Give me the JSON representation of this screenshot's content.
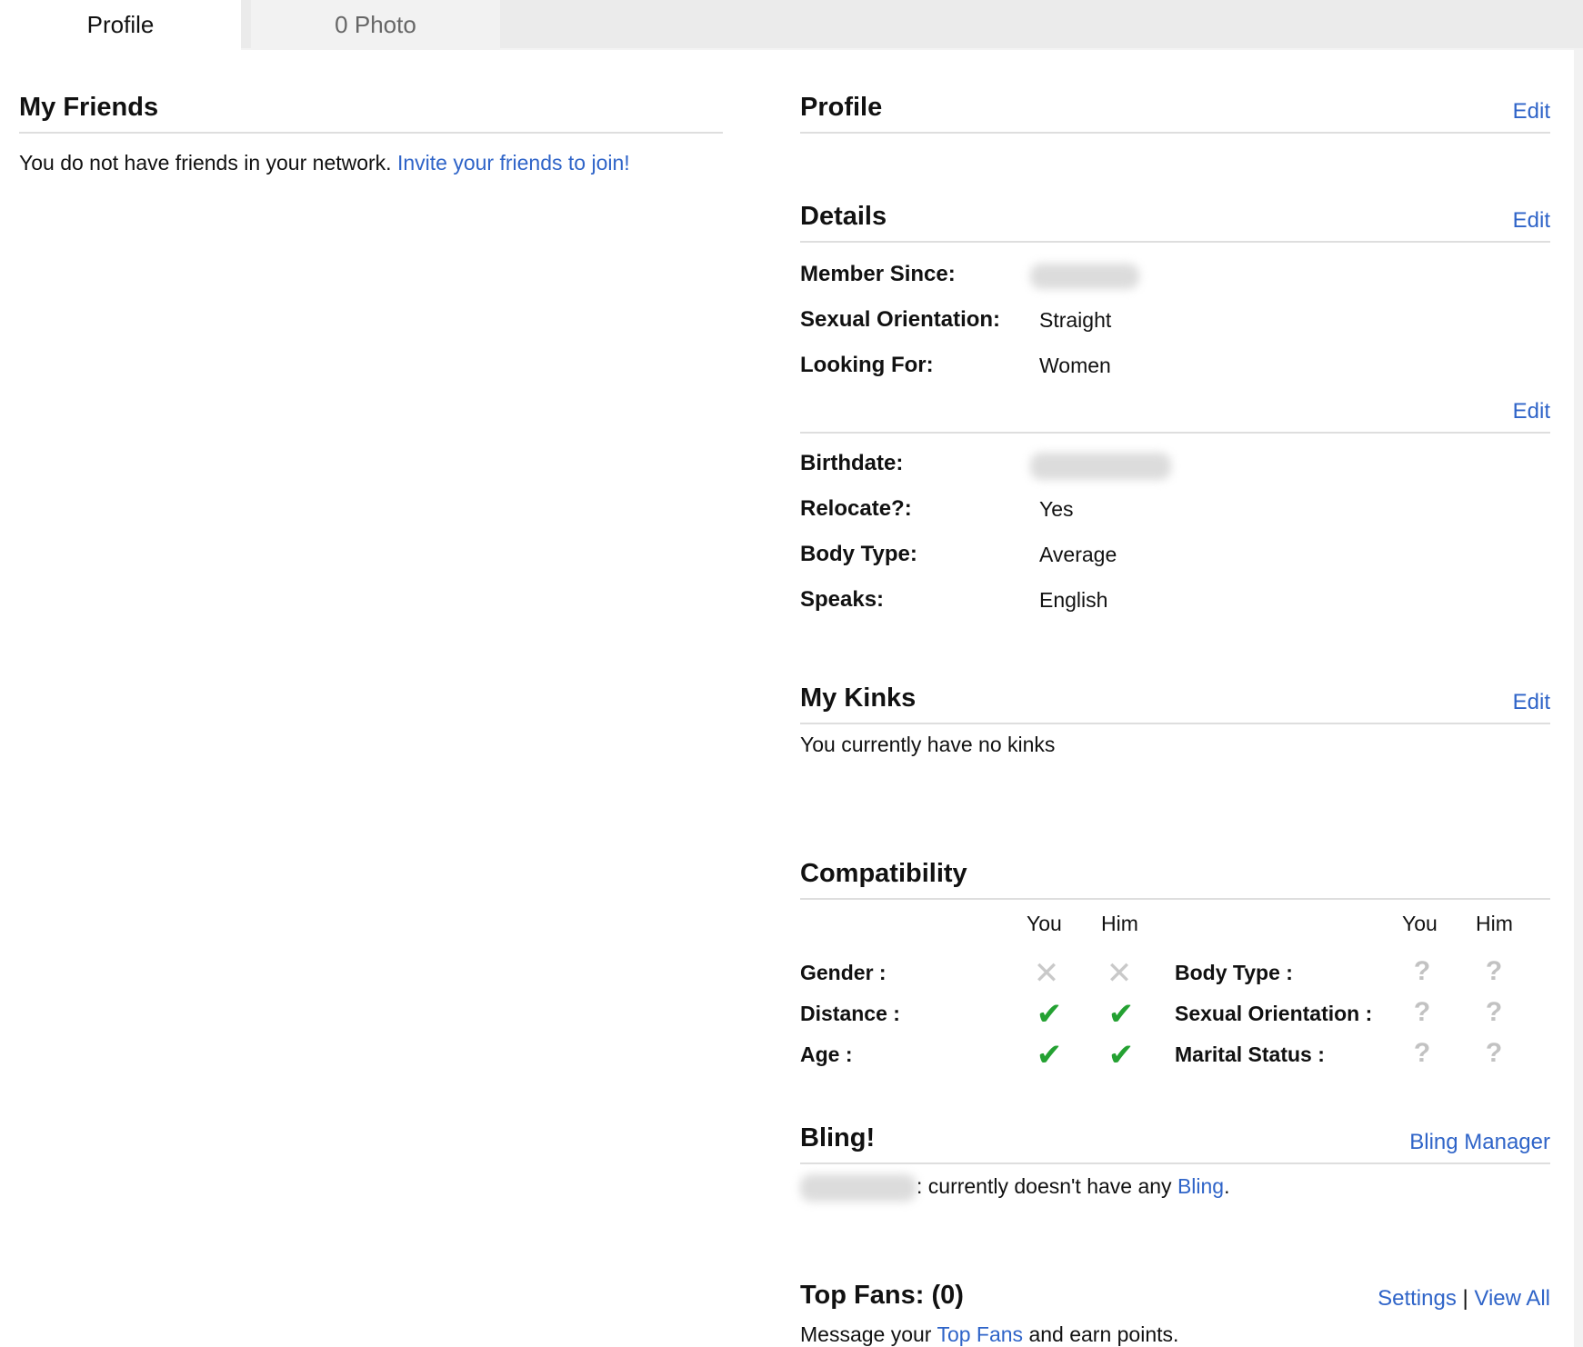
{
  "tabs": {
    "profile": "Profile",
    "photo": "0 Photo"
  },
  "friends": {
    "title": "My Friends",
    "message": "You do not have friends in your network.",
    "invite_link": "Invite your friends to join!"
  },
  "profile_section": {
    "title": "Profile",
    "edit": "Edit"
  },
  "details": {
    "title": "Details",
    "edit": "Edit",
    "group1": [
      {
        "label": "Member Since:",
        "value": null
      },
      {
        "label": "Sexual Orientation:",
        "value": "Straight"
      },
      {
        "label": "Looking For:",
        "value": "Women"
      }
    ],
    "edit2": "Edit",
    "group2": [
      {
        "label": "Birthdate:",
        "value": null
      },
      {
        "label": "Relocate?:",
        "value": "Yes"
      },
      {
        "label": "Body Type:",
        "value": "Average"
      },
      {
        "label": "Speaks:",
        "value": "English"
      }
    ]
  },
  "kinks": {
    "title": "My Kinks",
    "edit": "Edit",
    "message": "You currently have no kinks"
  },
  "compatibility": {
    "title": "Compatibility",
    "col_you": "You",
    "col_him": "Him",
    "left": [
      {
        "label": "Gender :",
        "you": "x",
        "him": "x"
      },
      {
        "label": "Distance :",
        "you": "check",
        "him": "check"
      },
      {
        "label": "Age :",
        "you": "check",
        "him": "check"
      }
    ],
    "right": [
      {
        "label": "Body Type :",
        "you": "?",
        "him": "?"
      },
      {
        "label": "Sexual Orientation :",
        "you": "?",
        "him": "?"
      },
      {
        "label": "Marital Status :",
        "you": "?",
        "him": "?"
      }
    ]
  },
  "bling": {
    "title": "Bling!",
    "manager_link": "Bling Manager",
    "message_suffix": ": currently doesn't have any",
    "bling_link": "Bling",
    "period": "."
  },
  "top_fans": {
    "title": "Top Fans: (0)",
    "settings_link": "Settings",
    "separator": "|",
    "view_all_link": "View All",
    "message_prefix": "Message your",
    "top_fans_link": "Top Fans",
    "message_suffix": "and earn points."
  },
  "icons": {
    "x": "cross-icon",
    "check": "checkmark-icon",
    "?": "question-icon"
  },
  "colors": {
    "link": "#2f64c8",
    "check": "#24a132",
    "muted_icon": "#c9c9c9",
    "divider": "#dedede"
  }
}
